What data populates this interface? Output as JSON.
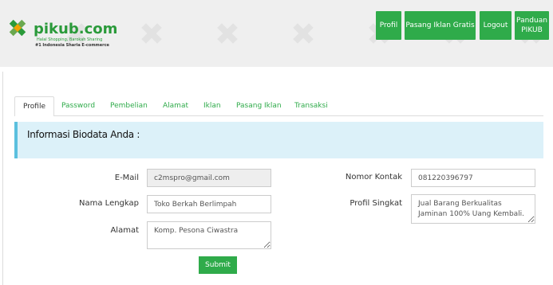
{
  "brand": {
    "name_main": "pikub",
    "name_tld": ".com",
    "tagline": "Halal Shopping, Barokah Sharing",
    "slogan": "#1 Indonesia Sharia E-commerce",
    "color": "#2a9a3a"
  },
  "nav": {
    "profil": "Profil",
    "pasang_iklan": "Pasang Iklan Gratis",
    "logout": "Logout",
    "panduan_line1": "Panduan",
    "panduan_line2": "PIKUB"
  },
  "tabs": [
    {
      "label": "Profile",
      "active": true
    },
    {
      "label": "Password"
    },
    {
      "label": "Pembelian"
    },
    {
      "label": "Alamat"
    },
    {
      "label": "Iklan"
    },
    {
      "label": "Pasang Iklan"
    },
    {
      "label": "Transaksi"
    }
  ],
  "panel": {
    "title": "Informasi Biodata Anda :"
  },
  "form": {
    "email": {
      "label": "E-Mail",
      "value": "c2mspro@gmail.com"
    },
    "nama": {
      "label": "Nama Lengkap",
      "value": "Toko Berkah Berlimpah"
    },
    "alamat": {
      "label": "Alamat",
      "value": "Komp. Pesona Ciwastra"
    },
    "kontak": {
      "label": "Nomor Kontak",
      "value": "081220396797"
    },
    "profil": {
      "label": "Profil Singkat",
      "value": "Jual Barang Berkualitas Jaminan 100% Uang Kembali."
    },
    "submit": "Submit"
  },
  "colors": {
    "accent": "#2fab4a",
    "panel_bg": "#dcf1f9",
    "panel_border": "#5bc0de"
  }
}
